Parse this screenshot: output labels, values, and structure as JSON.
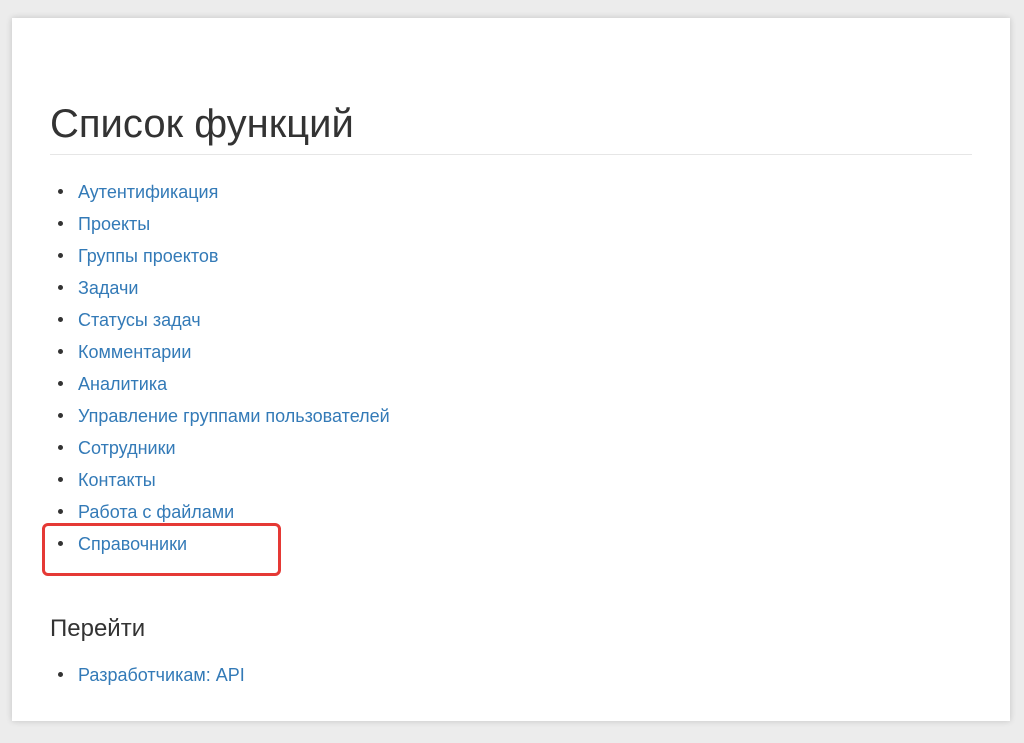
{
  "page": {
    "title": "Список функций",
    "functions": [
      {
        "label": "Аутентификация"
      },
      {
        "label": "Проекты"
      },
      {
        "label": "Группы проектов"
      },
      {
        "label": "Задачи"
      },
      {
        "label": "Статусы задач"
      },
      {
        "label": "Комментарии"
      },
      {
        "label": "Аналитика"
      },
      {
        "label": "Управление группами пользователей"
      },
      {
        "label": "Сотрудники"
      },
      {
        "label": "Контакты"
      },
      {
        "label": "Работа с файлами"
      },
      {
        "label": "Справочники"
      }
    ],
    "goto_title": "Перейти",
    "goto_links": [
      {
        "label": "Разработчикам: API"
      }
    ]
  },
  "colors": {
    "link": "#337ab7",
    "highlight": "#e53935",
    "text": "#333333"
  }
}
